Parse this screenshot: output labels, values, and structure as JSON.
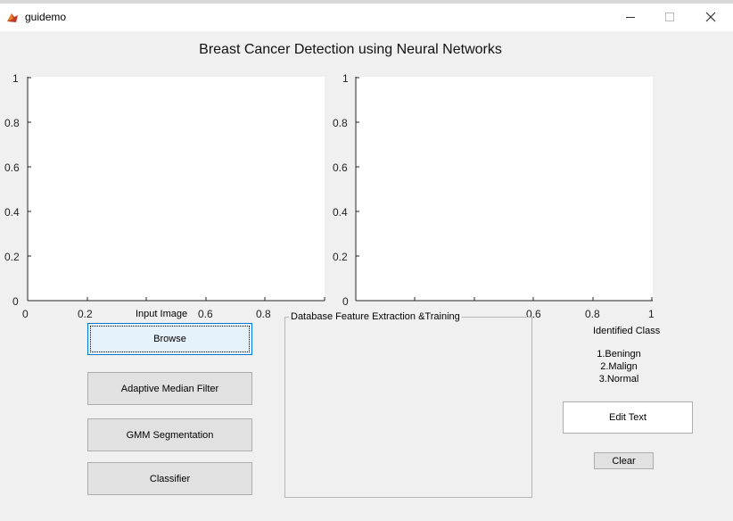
{
  "window": {
    "title": "guidemo"
  },
  "heading": "Breast Cancer Detection using Neural Networks",
  "axes_left": {
    "yticks": [
      "1",
      "0.8",
      "0.6",
      "0.4",
      "0.2",
      "0"
    ],
    "xticks": [
      "0",
      "0.2",
      "0.6",
      "0.8"
    ]
  },
  "axes_right": {
    "yticks": [
      "1",
      "0.8",
      "0.6",
      "0.4",
      "0.2",
      "0"
    ],
    "xticks": [
      "0.6",
      "0.8",
      "1"
    ]
  },
  "input_image_label": "Input Image",
  "buttons": {
    "browse": "Browse",
    "adaptive": "Adaptive Median Filter",
    "gmm": "GMM Segmentation",
    "classifier": "Classifier",
    "clear": "Clear"
  },
  "panel": {
    "title": "Database Feature Extraction &Training"
  },
  "identified_class_label": "Identified Class",
  "classes": [
    "1.Beningn",
    "2.Malign",
    "3.Normal"
  ],
  "edit_text": "Edit Text"
}
